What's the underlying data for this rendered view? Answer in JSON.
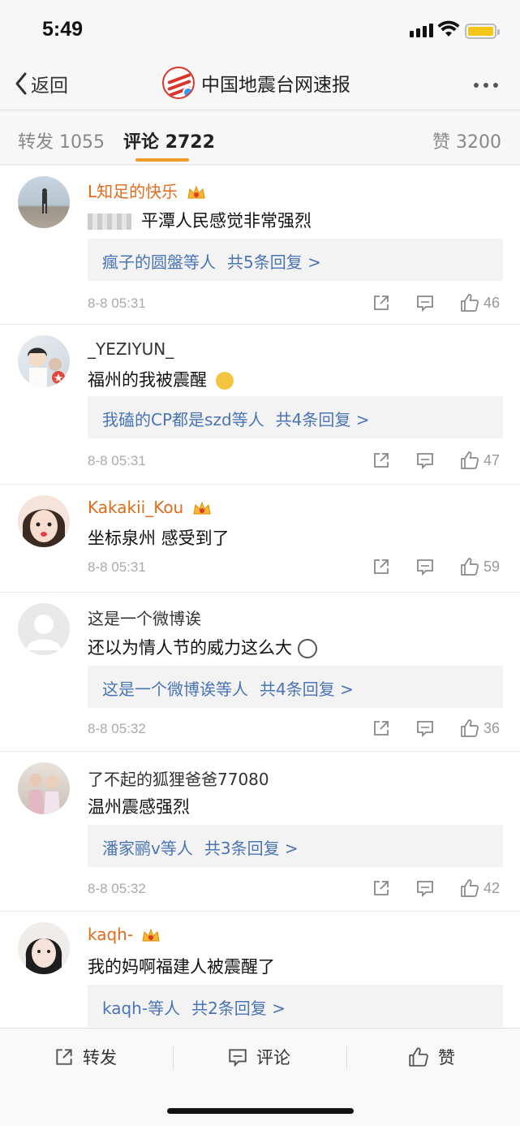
{
  "status": {
    "time": "5:49"
  },
  "nav": {
    "back_label": "返回",
    "title": "中国地震台网速报"
  },
  "tabs": {
    "repost": "转发 1055",
    "comments": "评论 2722",
    "likes": "赞 3200"
  },
  "comments": [
    {
      "name": "L知足的快乐",
      "vip": true,
      "text": "平潭人民感觉非常强烈",
      "reply": "瘋子的圆盤等人",
      "reply_count": "共5条回复 >",
      "time": "8-8 05:31",
      "likes": "46"
    },
    {
      "name": "_YEZIYUN_",
      "vip": false,
      "text": "福州的我被震醒",
      "reply": "我磕的CP都是szd等人",
      "reply_count": "共4条回复 >",
      "time": "8-8 05:31",
      "likes": "47"
    },
    {
      "name": "Kakakii_Kou",
      "vip": true,
      "text": "坐标泉州 感受到了",
      "time": "8-8 05:31",
      "likes": "59"
    },
    {
      "name": "这是一个微博诶",
      "vip": false,
      "text": "还以为情人节的威力这么大",
      "reply": "这是一个微博诶等人",
      "reply_count": "共4条回复 >",
      "time": "8-8 05:32",
      "likes": "36"
    },
    {
      "name": "了不起的狐狸爸爸77080",
      "vip": false,
      "text": "温州震感强烈",
      "reply": "潘家鹂v等人",
      "reply_count": "共3条回复 >",
      "time": "8-8 05:32",
      "likes": "42"
    },
    {
      "name": "kaqh-",
      "vip": true,
      "text": "我的妈啊福建人被震醒了",
      "reply": "kaqh-等人",
      "reply_count": "共2条回复 >"
    }
  ],
  "bottom": {
    "repost": "转发",
    "comment": "评论",
    "like": "赞"
  },
  "colors": {
    "vip_name": "#e26b1b",
    "link": "#4a74b5",
    "tab_accent": "#f39c29"
  }
}
